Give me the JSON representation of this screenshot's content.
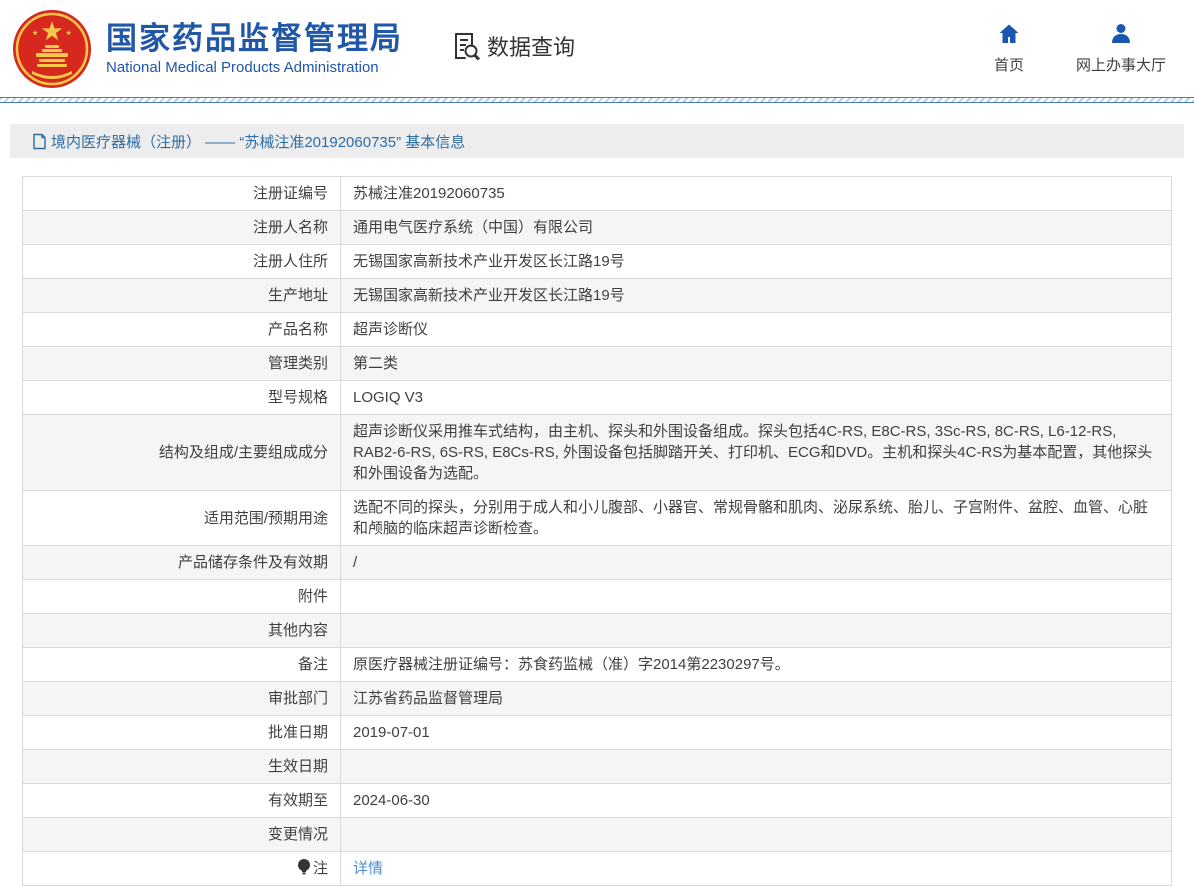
{
  "header": {
    "org_name_cn": "国家药品监督管理局",
    "org_name_en": "National Medical Products Administration",
    "section_title": "数据查询",
    "nav": [
      {
        "label": "首页",
        "icon": "home-icon"
      },
      {
        "label": "网上办事大厅",
        "icon": "person-icon"
      }
    ]
  },
  "breadcrumb": {
    "text": "境内医疗器械（注册） —— “苏械注准20192060735” 基本信息"
  },
  "table": {
    "rows": [
      {
        "label": "注册证编号",
        "value": "苏械注准20192060735"
      },
      {
        "label": "注册人名称",
        "value": "通用电气医疗系统（中国）有限公司"
      },
      {
        "label": "注册人住所",
        "value": "无锡国家高新技术产业开发区长江路19号"
      },
      {
        "label": "生产地址",
        "value": "无锡国家高新技术产业开发区长江路19号"
      },
      {
        "label": "产品名称",
        "value": "超声诊断仪"
      },
      {
        "label": "管理类别",
        "value": "第二类"
      },
      {
        "label": "型号规格",
        "value": "LOGIQ V3"
      },
      {
        "label": "结构及组成/主要组成成分",
        "value": "超声诊断仪采用推车式结构，由主机、探头和外围设备组成。探头包括4C-RS, E8C-RS, 3Sc-RS, 8C-RS, L6-12-RS, RAB2-6-RS, 6S-RS, E8Cs-RS, 外围设备包括脚踏开关、打印机、ECG和DVD。主机和探头4C-RS为基本配置，其他探头和外围设备为选配。"
      },
      {
        "label": "适用范围/预期用途",
        "value": "选配不同的探头，分别用于成人和小儿腹部、小器官、常规骨骼和肌肉、泌尿系统、胎儿、子宫附件、盆腔、血管、心脏和颅脑的临床超声诊断检查。"
      },
      {
        "label": "产品储存条件及有效期",
        "value": "/"
      },
      {
        "label": "附件",
        "value": ""
      },
      {
        "label": "其他内容",
        "value": ""
      },
      {
        "label": "备注",
        "value": "原医疗器械注册证编号：苏食药监械（准）字2014第2230297号。"
      },
      {
        "label": "审批部门",
        "value": "江苏省药品监督管理局"
      },
      {
        "label": "批准日期",
        "value": "2019-07-01"
      },
      {
        "label": "生效日期",
        "value": ""
      },
      {
        "label": "有效期至",
        "value": "2024-06-30"
      },
      {
        "label": "变更情况",
        "value": ""
      },
      {
        "label": "注",
        "icon": "bulb",
        "value": "详情",
        "link": true
      }
    ]
  },
  "colors": {
    "brand_blue": "#2057a7",
    "nav_icon_blue": "#1a56b0",
    "breadcrumb_text": "#2e6da4",
    "link_blue": "#4a90d9",
    "table_border": "#d9d9d9",
    "row_alt_bg": "#f5f5f5",
    "emblem_red": "#d6281e",
    "emblem_gold": "#f7c948"
  }
}
